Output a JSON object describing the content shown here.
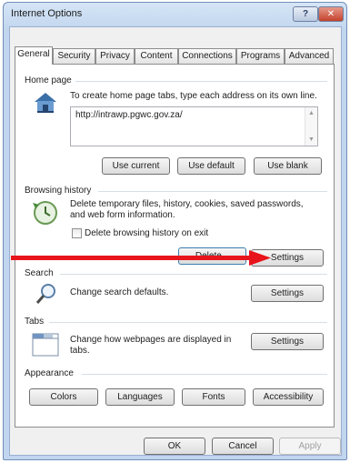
{
  "window": {
    "title": "Internet Options",
    "help_label": "?",
    "close_label": "✕"
  },
  "tabs": [
    {
      "label": "General",
      "active": true
    },
    {
      "label": "Security",
      "active": false
    },
    {
      "label": "Privacy",
      "active": false
    },
    {
      "label": "Content",
      "active": false
    },
    {
      "label": "Connections",
      "active": false
    },
    {
      "label": "Programs",
      "active": false
    },
    {
      "label": "Advanced",
      "active": false
    }
  ],
  "home_page": {
    "section_label": "Home page",
    "description": "To create home page tabs, type each address on its own line.",
    "url_value": "http://intrawp.pgwc.gov.za/",
    "use_current_label": "Use current",
    "use_default_label": "Use default",
    "use_blank_label": "Use blank"
  },
  "browsing_history": {
    "section_label": "Browsing history",
    "description_line1": "Delete temporary files, history, cookies, saved passwords,",
    "description_line2": "and web form information.",
    "checkbox_label": "Delete browsing history on exit",
    "checkbox_checked": false,
    "delete_label": "Delete...",
    "settings_label": "Settings"
  },
  "search": {
    "section_label": "Search",
    "description": "Change search defaults.",
    "settings_label": "Settings"
  },
  "tabs_section": {
    "section_label": "Tabs",
    "description_line1": "Change how webpages are displayed in",
    "description_line2": "tabs.",
    "settings_label": "Settings"
  },
  "appearance": {
    "section_label": "Appearance",
    "colors_label": "Colors",
    "languages_label": "Languages",
    "fonts_label": "Fonts",
    "accessibility_label": "Accessibility"
  },
  "footer": {
    "ok_label": "OK",
    "cancel_label": "Cancel",
    "apply_label": "Apply"
  },
  "annotation": {
    "arrow_color": "#e8141b"
  },
  "colors": {
    "title_gradient_top": "#d6e5f6",
    "close_button": "#c4412b",
    "focus_border": "#3c7fb1"
  }
}
